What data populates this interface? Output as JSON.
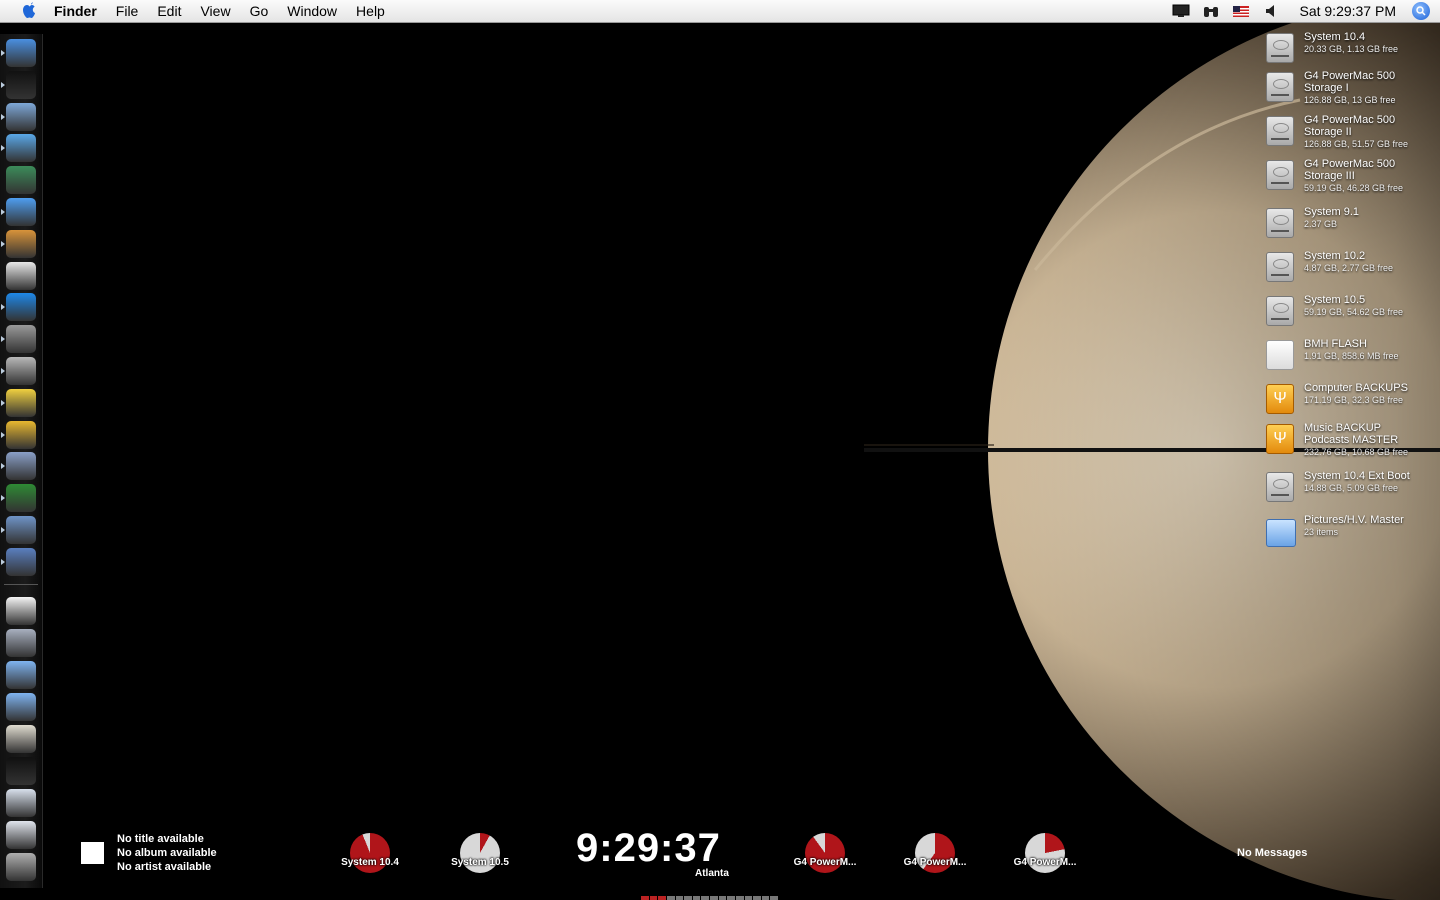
{
  "menubar": {
    "app_name": "Finder",
    "menus": [
      "File",
      "Edit",
      "View",
      "Go",
      "Window",
      "Help"
    ],
    "clock": "Sat 9:29:37 PM",
    "extras": [
      "display-icon",
      "binoculars-icon",
      "us-flag-icon",
      "volume-icon"
    ]
  },
  "dock": {
    "items": [
      "finder",
      "activity-monitor",
      "mail",
      "itunes",
      "dashboard",
      "safari",
      "iphoto",
      "ical",
      "quicktime",
      "system-preferences",
      "disk-utility",
      "aim",
      "camino",
      "jewel-app",
      "network-app",
      "preview",
      "migration-assistant",
      "textedit-doc",
      "cd",
      "documents-folder",
      "applications-folder",
      "home-folder",
      "terminal",
      "email-doc",
      "web-doc",
      "trash"
    ]
  },
  "desktop": {
    "icons": [
      {
        "name": "System 10.4",
        "info": "20.33 GB, 1.13 GB free",
        "kind": "hd"
      },
      {
        "name": "G4 PowerMac 500 Storage I",
        "info": "126.88 GB, 13 GB free",
        "kind": "hd"
      },
      {
        "name": "G4 PowerMac 500 Storage II",
        "info": "126.88 GB, 51.57 GB free",
        "kind": "hd"
      },
      {
        "name": "G4 PowerMac 500 Storage III",
        "info": "59.19 GB, 46.28 GB free",
        "kind": "hd"
      },
      {
        "name": "System 9.1",
        "info": "2.37 GB",
        "kind": "hd"
      },
      {
        "name": "System 10.2",
        "info": "4.87 GB, 2.77 GB free",
        "kind": "hd"
      },
      {
        "name": "System 10.5",
        "info": "59.19 GB, 54.62 GB free",
        "kind": "hd"
      },
      {
        "name": "BMH FLASH",
        "info": "1.91 GB, 858.6 MB free",
        "kind": "flash"
      },
      {
        "name": "Computer BACKUPS",
        "info": "171.19 GB, 32.3 GB free",
        "kind": "usb"
      },
      {
        "name": "Music BACKUP Podcasts MASTER",
        "info": "232.76 GB, 10.68 GB free",
        "kind": "usb"
      },
      {
        "name": "System 10.4 Ext Boot",
        "info": "14.88 GB, 5.09 GB free",
        "kind": "hd"
      },
      {
        "name": "Pictures/H.V. Master",
        "info": "23 items",
        "kind": "folder"
      }
    ]
  },
  "itunes_widget": {
    "title": "No title available",
    "album": "No album available",
    "artist": "No artist available"
  },
  "disk_widgets": [
    {
      "label": "System 10.4",
      "used_fraction": 0.94
    },
    {
      "label": "System 10.5",
      "used_fraction": 0.08
    },
    {
      "label": "G4 PowerM...",
      "used_fraction": 0.9
    },
    {
      "label": "G4 PowerM...",
      "used_fraction": 0.6
    },
    {
      "label": "G4 PowerM...",
      "used_fraction": 0.22
    }
  ],
  "clock_widget": {
    "time": "9:29:37",
    "city": "Atlanta"
  },
  "mail_widget": {
    "status": "No Messages"
  },
  "colors": {
    "pie_used": "#b0151a",
    "pie_free": "#d8d8d8"
  }
}
